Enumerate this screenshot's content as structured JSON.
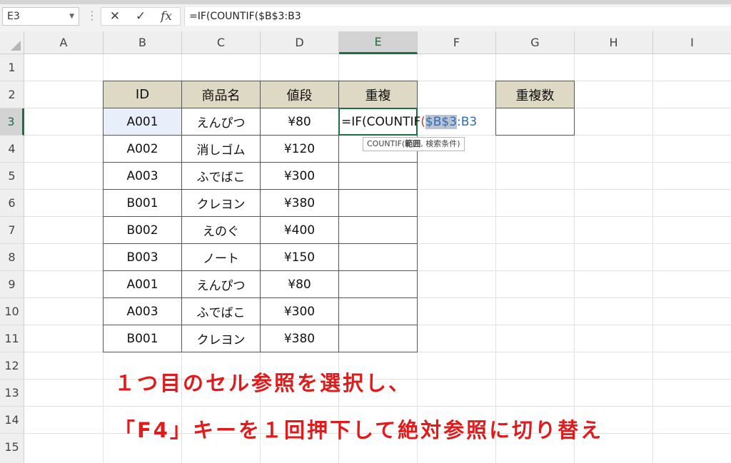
{
  "formula_bar": {
    "name_box": "E3",
    "cancel_icon": "✕",
    "enter_icon": "✓",
    "fx_label": "fx",
    "formula": "=IF(COUNTIF($B$3:B3"
  },
  "columns": [
    "A",
    "B",
    "C",
    "D",
    "E",
    "F",
    "G",
    "H",
    "I"
  ],
  "rows": [
    "1",
    "2",
    "3",
    "4",
    "5",
    "6",
    "7",
    "8",
    "9",
    "10",
    "11",
    "12",
    "13",
    "14",
    "15"
  ],
  "table": {
    "headers": [
      "ID",
      "商品名",
      "値段",
      "重複"
    ],
    "rows": [
      [
        "A001",
        "えんぴつ",
        "¥80"
      ],
      [
        "A002",
        "消しゴム",
        "¥120"
      ],
      [
        "A003",
        "ふでばこ",
        "¥300"
      ],
      [
        "B001",
        "クレヨン",
        "¥380"
      ],
      [
        "B002",
        "えのぐ",
        "¥400"
      ],
      [
        "B003",
        "ノート",
        "¥150"
      ],
      [
        "A001",
        "えんぴつ",
        "¥80"
      ],
      [
        "A003",
        "ふでばこ",
        "¥300"
      ],
      [
        "B001",
        "クレヨン",
        "¥380"
      ]
    ]
  },
  "edit_cell": {
    "prefix": "=IF(COUNTIF",
    "paren": "(",
    "ref_selected": "$B$3",
    "ref_rest": ":B3"
  },
  "tooltip": {
    "fn": "COUNTIF(",
    "arg1": "範囲",
    "rest": ", 検索条件)"
  },
  "count_box": {
    "header": "重複数",
    "value": ""
  },
  "annotation": {
    "line1": "１つ目のセル参照を選択し、",
    "line2": "「F4」キーを１回押下して絶対参照に切り替え"
  },
  "colors": {
    "header_fill": "#ddd9c4",
    "active_cell_border": "#1e6e43",
    "annotation": "#e11b1b",
    "ref_text": "#2f6cb5",
    "paren_text": "#d9342b"
  }
}
